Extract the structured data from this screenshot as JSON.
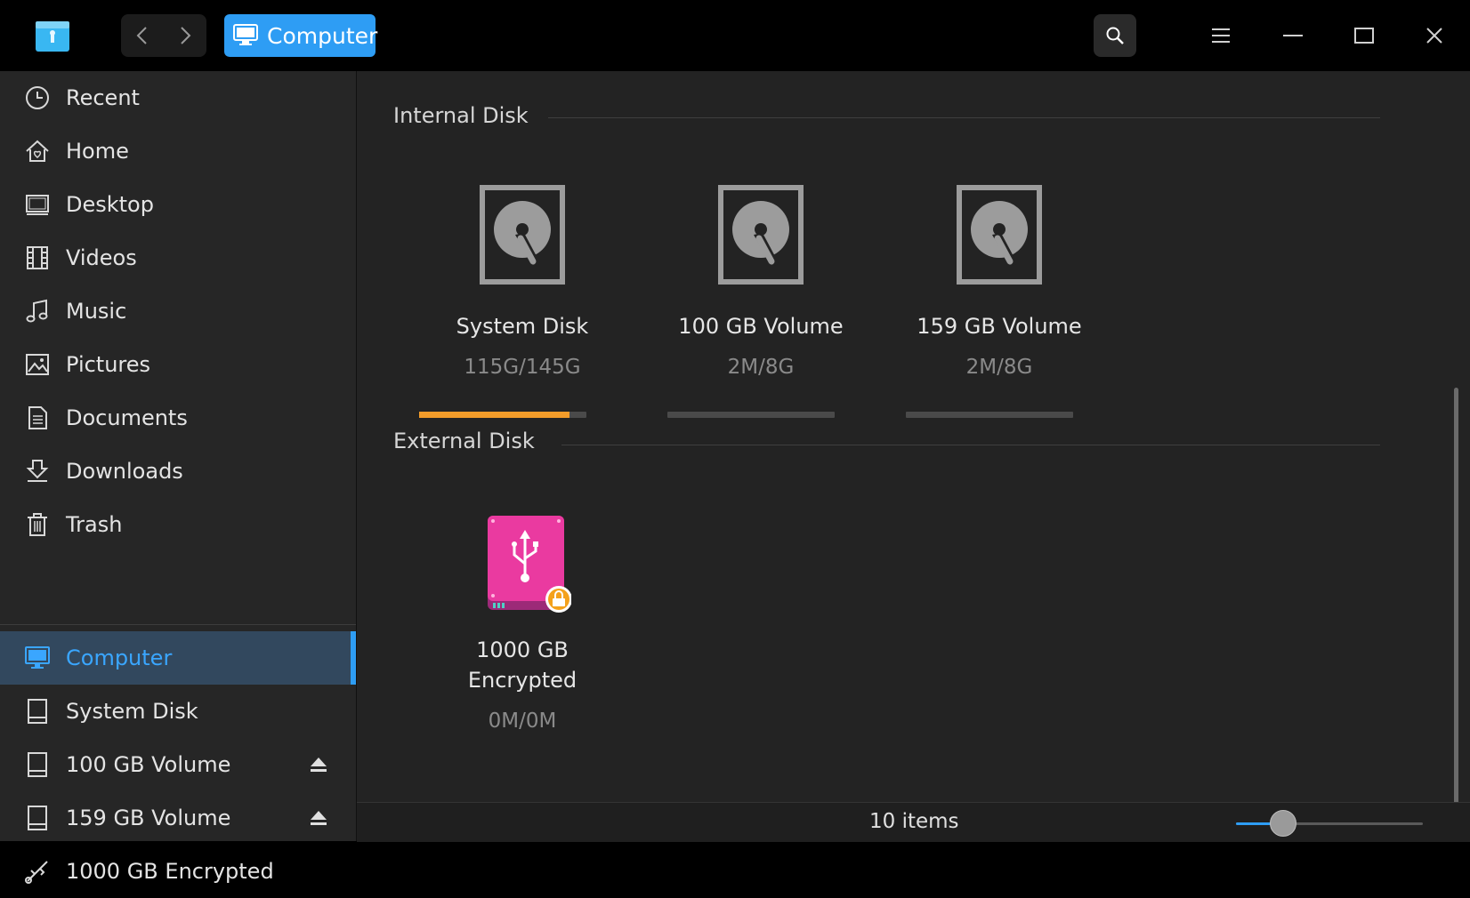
{
  "header": {
    "breadcrumb_label": "Computer",
    "icons": [
      "app-logo-icon",
      "back-icon",
      "forward-icon",
      "monitor-icon",
      "search-icon",
      "menu-icon",
      "minimize-icon",
      "maximize-icon",
      "close-icon"
    ]
  },
  "sidebar": {
    "items": [
      {
        "label": "Recent",
        "icon": "clock-icon"
      },
      {
        "label": "Home",
        "icon": "home-icon"
      },
      {
        "label": "Desktop",
        "icon": "desktop-icon"
      },
      {
        "label": "Videos",
        "icon": "film-icon"
      },
      {
        "label": "Music",
        "icon": "music-icon"
      },
      {
        "label": "Pictures",
        "icon": "picture-icon"
      },
      {
        "label": "Documents",
        "icon": "document-icon"
      },
      {
        "label": "Downloads",
        "icon": "download-icon"
      },
      {
        "label": "Trash",
        "icon": "trash-icon"
      }
    ],
    "devices": [
      {
        "label": "Computer",
        "icon": "computer-icon",
        "active": true
      },
      {
        "label": "System Disk",
        "icon": "disk-icon"
      },
      {
        "label": "100 GB Volume",
        "icon": "disk-icon",
        "eject": true
      },
      {
        "label": "159 GB Volume",
        "icon": "disk-icon",
        "eject": true
      },
      {
        "label": "1000 GB Encrypted",
        "icon": "usb-icon"
      }
    ]
  },
  "main": {
    "internal_title": "Internal Disk",
    "external_title": "External Disk",
    "internal_disks": [
      {
        "name": "System Disk",
        "usage": "115G/145G",
        "used_fraction": 0.9
      },
      {
        "name": "100 GB Volume",
        "usage": "2M/8G",
        "used_fraction": 0.0
      },
      {
        "name": "159 GB Volume",
        "usage": "2M/8G",
        "used_fraction": 0.0
      }
    ],
    "external_disks": [
      {
        "name": "1000 GB Encrypted",
        "usage": "0M/0M"
      }
    ]
  },
  "status": {
    "items_count": "10 items",
    "zoom_fraction": 0.25
  },
  "colors": {
    "accent": "#2e9df4",
    "usage_bar": "#f39c2a",
    "usb_pink": "#e8339a"
  }
}
